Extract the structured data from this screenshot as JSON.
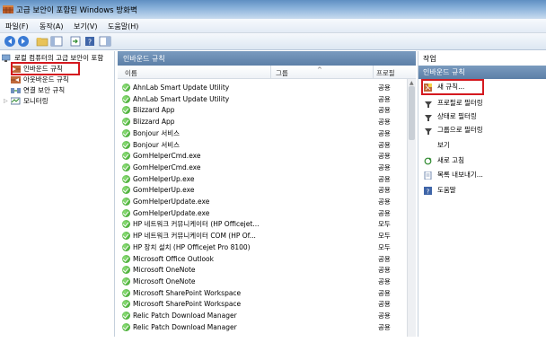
{
  "window": {
    "title": "고급 보안이 포함된 Windows 방화벽"
  },
  "menu": [
    "파일(F)",
    "동작(A)",
    "보기(V)",
    "도움말(H)"
  ],
  "toolbar": {
    "buttons": [
      "back-arrow-icon",
      "forward-arrow-icon",
      "folder-up-icon",
      "console-tree-icon",
      "refresh-icon",
      "help-icon"
    ]
  },
  "tree": {
    "root": "로컬 컴퓨터의 고급 보안이 포함",
    "items": [
      "인바운드 규칙",
      "아웃바운드 규칙",
      "연결 보안 규칙",
      "모니터링"
    ]
  },
  "center": {
    "header": "인바운드 규칙",
    "columns": {
      "name": "이름",
      "group": "그룹",
      "profile": "프로필"
    },
    "rules": [
      {
        "name": "AhnLab Smart Update Utility",
        "profile": "공용"
      },
      {
        "name": "AhnLab Smart Update Utility",
        "profile": "공용"
      },
      {
        "name": "Blizzard App",
        "profile": "공용"
      },
      {
        "name": "Blizzard App",
        "profile": "공용"
      },
      {
        "name": "Bonjour 서비스",
        "profile": "공용"
      },
      {
        "name": "Bonjour 서비스",
        "profile": "공용"
      },
      {
        "name": "GomHelperCmd.exe",
        "profile": "공용"
      },
      {
        "name": "GomHelperCmd.exe",
        "profile": "공용"
      },
      {
        "name": "GomHelperUp.exe",
        "profile": "공용"
      },
      {
        "name": "GomHelperUp.exe",
        "profile": "공용"
      },
      {
        "name": "GomHelperUpdate.exe",
        "profile": "공용"
      },
      {
        "name": "GomHelperUpdate.exe",
        "profile": "공용"
      },
      {
        "name": "HP 네트워크 커뮤니케이터 (HP Officejet...",
        "profile": "모두"
      },
      {
        "name": "HP 네트워크 커뮤니케이터 COM (HP Of...",
        "profile": "모두"
      },
      {
        "name": "HP 장치 설치 (HP Officejet Pro 8100)",
        "profile": "모두"
      },
      {
        "name": "Microsoft Office Outlook",
        "profile": "공용"
      },
      {
        "name": "Microsoft OneNote",
        "profile": "공용"
      },
      {
        "name": "Microsoft OneNote",
        "profile": "공용"
      },
      {
        "name": "Microsoft SharePoint Workspace",
        "profile": "공용"
      },
      {
        "name": "Microsoft SharePoint Workspace",
        "profile": "공용"
      },
      {
        "name": "Relic Patch Download Manager",
        "profile": "공용"
      },
      {
        "name": "Relic Patch Download Manager",
        "profile": "공용"
      }
    ]
  },
  "actions": {
    "title": "작업",
    "group": "인바운드 규칙",
    "items": [
      {
        "label": "새 규칙...",
        "icon": "new-rule-icon"
      },
      {
        "label": "프로필로 필터링",
        "icon": "filter-icon"
      },
      {
        "label": "상태로 필터링",
        "icon": "filter-icon"
      },
      {
        "label": "그룹으로 필터링",
        "icon": "filter-icon"
      },
      {
        "label": "보기",
        "icon": ""
      },
      {
        "label": "새로 고침",
        "icon": "refresh-icon"
      },
      {
        "label": "목록 내보내기...",
        "icon": "export-icon"
      },
      {
        "label": "도움말",
        "icon": "help-icon"
      }
    ]
  },
  "colors": {
    "highlight_box": "#d4191f",
    "pane_header": "#5c7fa7",
    "check_green": "#2f9a1e"
  }
}
